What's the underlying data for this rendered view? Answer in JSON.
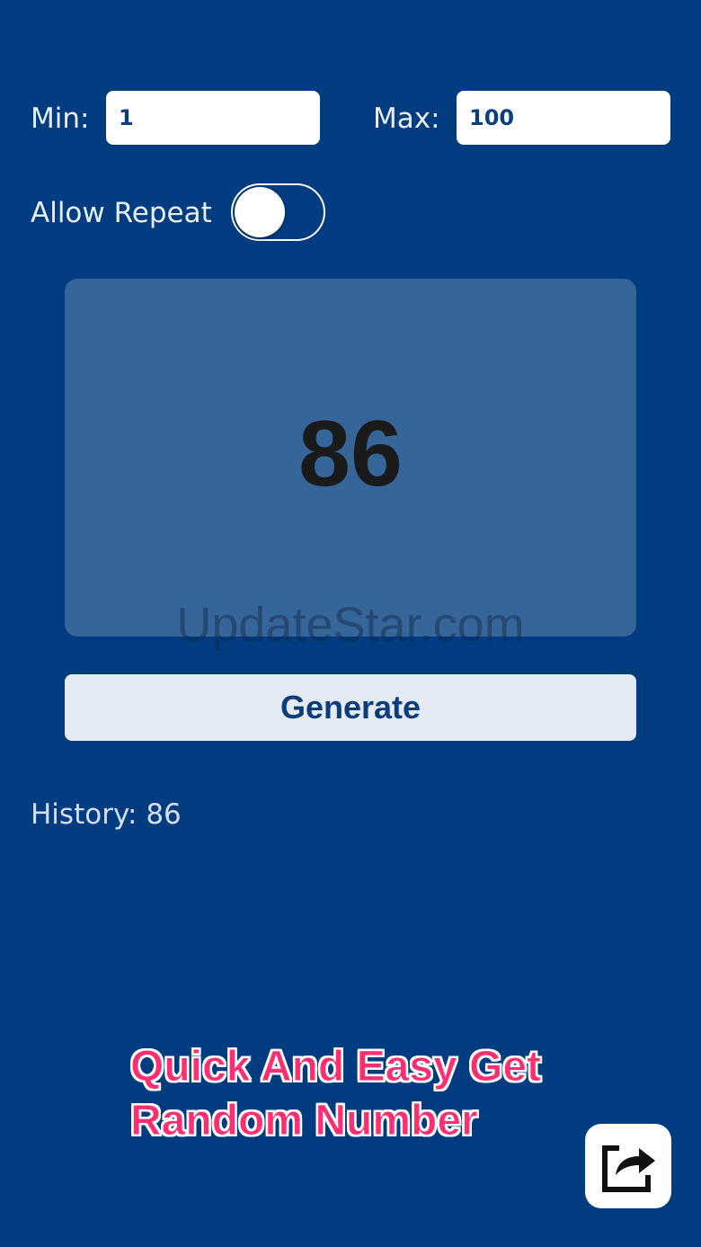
{
  "range": {
    "min_label": "Min:",
    "min_value": "1",
    "max_label": "Max:",
    "max_value": "100"
  },
  "repeat": {
    "label": "Allow Repeat",
    "enabled": false
  },
  "result": {
    "value": "86"
  },
  "watermark": "UpdateStar.com",
  "generate": {
    "label": "Generate"
  },
  "history": {
    "text": "History: 86"
  },
  "promo": {
    "line1": "Quick And Easy Get",
    "line2": "Random Number"
  },
  "share": {
    "icon": "share-icon"
  },
  "colors": {
    "background": "#013c80",
    "result_box": "#356599",
    "button": "#e5ebf4",
    "promo_text": "#ff2d71"
  }
}
